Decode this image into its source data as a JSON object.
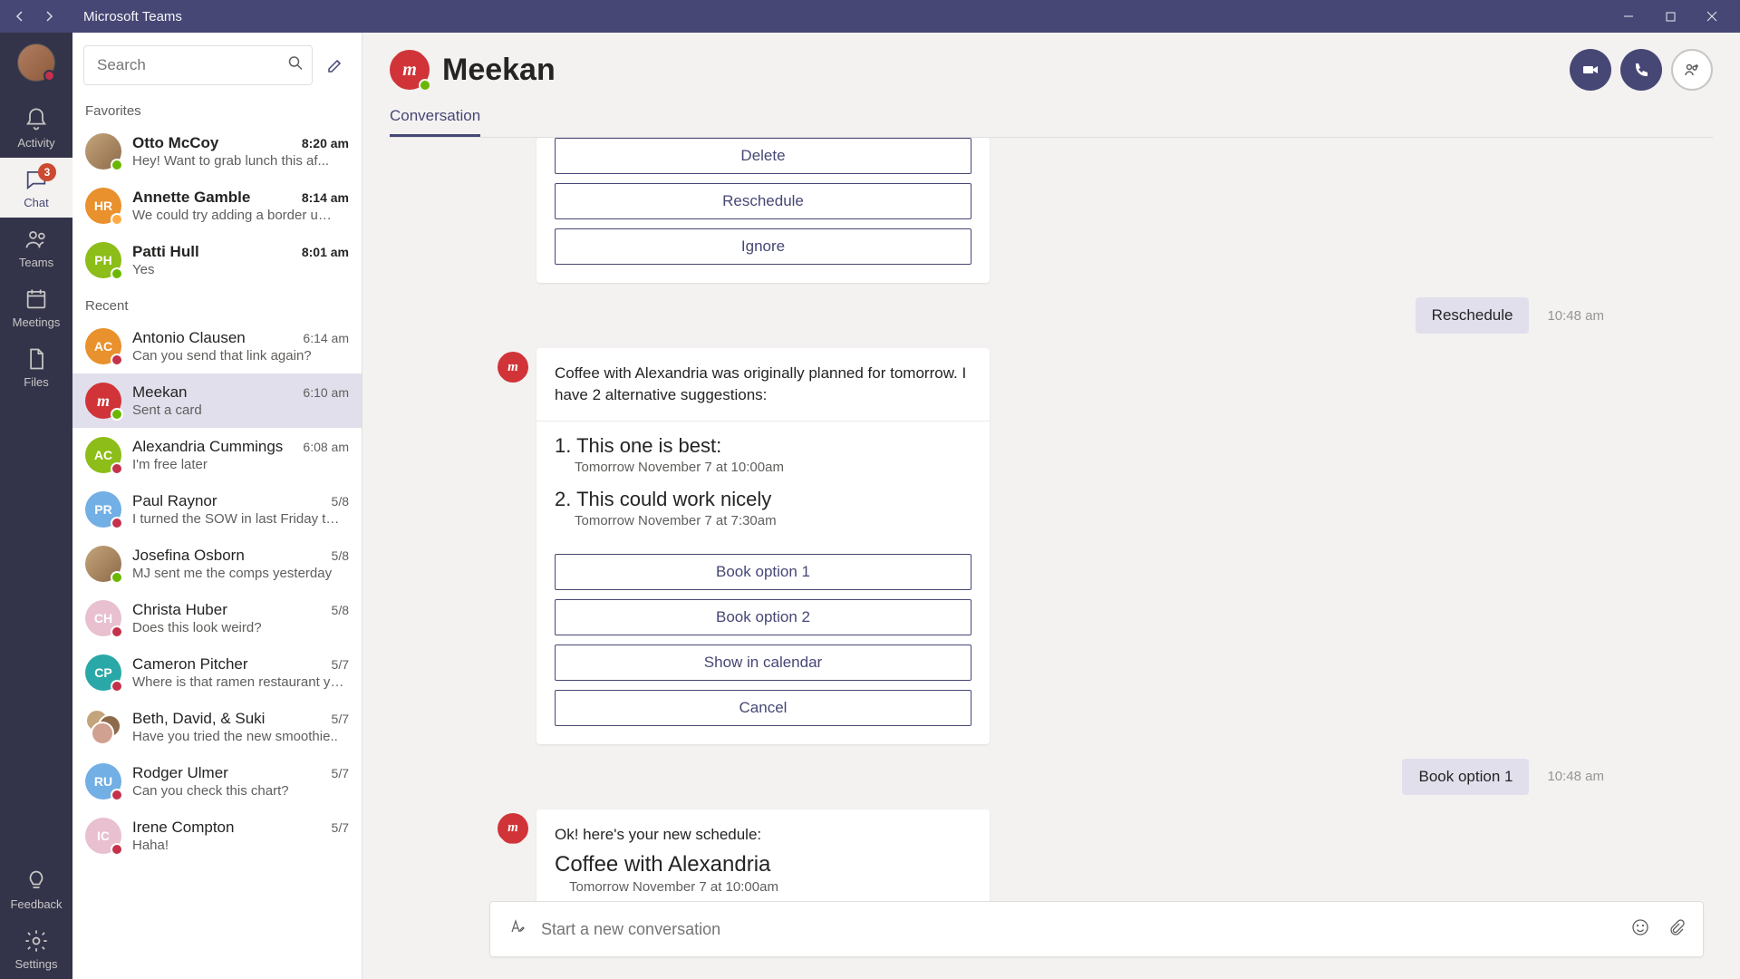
{
  "titlebar": {
    "app_title": "Microsoft Teams"
  },
  "rail": {
    "badge": "3",
    "items": {
      "activity": "Activity",
      "chat": "Chat",
      "teams": "Teams",
      "meetings": "Meetings",
      "files": "Files",
      "feedback": "Feedback",
      "settings": "Settings"
    }
  },
  "chatlist": {
    "search_placeholder": "Search",
    "favorites_label": "Favorites",
    "recent_label": "Recent",
    "favorites": [
      {
        "name": "Otto McCoy",
        "time": "8:20 am",
        "preview": "Hey! Want to grab lunch this af...",
        "unread": true,
        "avatar_type": "photo",
        "presence": "online"
      },
      {
        "name": "Annette Gamble",
        "time": "8:14 am",
        "preview": "We could try adding a border u…",
        "unread": true,
        "avatar_type": "initials",
        "initials": "HR",
        "color": "#e8912d",
        "presence": "away"
      },
      {
        "name": "Patti Hull",
        "time": "8:01 am",
        "preview": "Yes",
        "unread": true,
        "avatar_type": "initials",
        "initials": "PH",
        "color": "#8cbd18",
        "presence": "online"
      }
    ],
    "recent": [
      {
        "name": "Antonio Clausen",
        "time": "6:14 am",
        "preview": "Can you send that link again?",
        "avatar_type": "initials",
        "initials": "AC",
        "color": "#e8912d",
        "presence": "busy"
      },
      {
        "name": "Meekan",
        "time": "6:10 am",
        "preview": "Sent a card",
        "avatar_type": "meekan",
        "selected": true,
        "presence": "online"
      },
      {
        "name": "Alexandria Cummings",
        "time": "6:08 am",
        "preview": "I'm free later",
        "avatar_type": "initials",
        "initials": "AC",
        "color": "#8cbd18",
        "presence": "busy"
      },
      {
        "name": "Paul Raynor",
        "time": "5/8",
        "preview": "I turned the SOW in last Friday t…",
        "avatar_type": "initials",
        "initials": "PR",
        "color": "#71afe5",
        "presence": "busy"
      },
      {
        "name": "Josefina Osborn",
        "time": "5/8",
        "preview": "MJ sent me the comps yesterday",
        "avatar_type": "photo",
        "presence": "online"
      },
      {
        "name": "Christa Huber",
        "time": "5/8",
        "preview": "Does this look weird?",
        "avatar_type": "initials",
        "initials": "CH",
        "color": "#e8c0d0",
        "presence": "busy"
      },
      {
        "name": "Cameron Pitcher",
        "time": "5/7",
        "preview": "Where is that ramen restaurant yo…",
        "avatar_type": "initials",
        "initials": "CP",
        "color": "#2aa8a8",
        "presence": "busy"
      },
      {
        "name": "Beth, David, & Suki",
        "time": "5/7",
        "preview": "Have you tried the new smoothie..",
        "avatar_type": "group"
      },
      {
        "name": "Rodger Ulmer",
        "time": "5/7",
        "preview": "Can you check this chart?",
        "avatar_type": "initials",
        "initials": "RU",
        "color": "#71afe5",
        "presence": "busy"
      },
      {
        "name": "Irene Compton",
        "time": "5/7",
        "preview": "Haha!",
        "avatar_type": "initials",
        "initials": "IC",
        "color": "#e8c0d0",
        "presence": "busy"
      }
    ]
  },
  "conversation": {
    "title": "Meekan",
    "tab": "Conversation",
    "card1_buttons": {
      "delete": "Delete",
      "reschedule": "Reschedule",
      "ignore": "Ignore"
    },
    "reply1": {
      "text": "Reschedule",
      "time": "10:48 am"
    },
    "card2": {
      "intro": "Coffee with Alexandria was originally planned for tomorrow. I have 2 alternative suggestions:",
      "opt1_title": "1. This one is best:",
      "opt1_sub": "Tomorrow November 7 at 10:00am",
      "opt2_title": "2. This could work nicely",
      "opt2_sub": "Tomorrow November 7 at 7:30am",
      "btn_book1": "Book option 1",
      "btn_book2": "Book option 2",
      "btn_calendar": "Show in calendar",
      "btn_cancel": "Cancel"
    },
    "reply2": {
      "text": "Book option 1",
      "time": "10:48 am"
    },
    "card3": {
      "intro": "Ok! here's your new schedule:",
      "title": "Coffee with Alexandria",
      "sub": "Tomorrow November 7 at 10:00am"
    },
    "composer_placeholder": "Start a new conversation"
  }
}
